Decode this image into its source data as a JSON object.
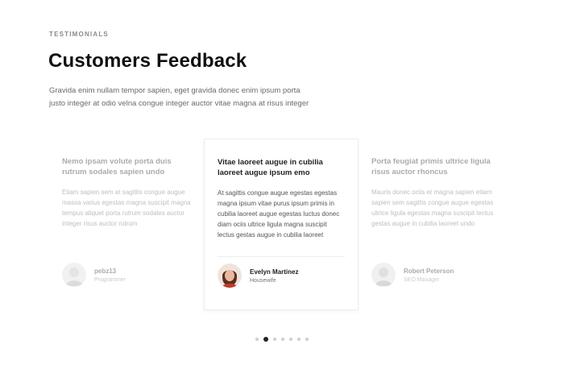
{
  "section": {
    "eyebrow": "TESTIMONIALS",
    "title": "Customers Feedback",
    "subtitle": "Gravida enim nullam tempor sapien, eget gravida donec enim ipsum porta justo integer at odio velna congue integer auctor vitae magna at risus integer"
  },
  "testimonials": [
    {
      "heading": "Nemo ipsam volute porta duis rutrum sodales sapien undo",
      "body": "Etiam sapien sem at sagittis congue augue massa varius egestas magna suscipit magna tempus aliquet porta rutrum sodales auctor integer risus auctor rutrum",
      "name": "pebz13",
      "role": "Programmer",
      "avatar_icon": "user-avatar-icon"
    },
    {
      "heading": "Vitae laoreet augue in cubilia laoreet augue ipsum emo",
      "body": "At sagittis congue augue egestas egestas magna ipsum vitae purus ipsum primis in cubilia laoreet augue egestas luctus donec diam ociis ultrice ligula magna suscipit lectus gestas augue in cubilia laoreet",
      "name": "Evelyn Martinez",
      "role": "Housewife",
      "avatar_icon": "user-avatar-icon"
    },
    {
      "heading": "Porta feugiat primis ultrice ligula risus auctor rhoncus",
      "body": "Mauris donec ociis et magna sapien etiam sapien sem sagittis congue augue egestas ultrice ligula egestas magna suscipit lectus gestas augue in cubilia laoreet undo",
      "name": "Robert Peterson",
      "role": "SEO Manager",
      "avatar_icon": "user-avatar-icon"
    }
  ],
  "pagination": {
    "count": 7,
    "active_index": 1
  },
  "colors": {
    "heading": "#111111",
    "text": "#555555",
    "dot_active": "#222222",
    "dot_inactive": "#cfcfcf"
  }
}
